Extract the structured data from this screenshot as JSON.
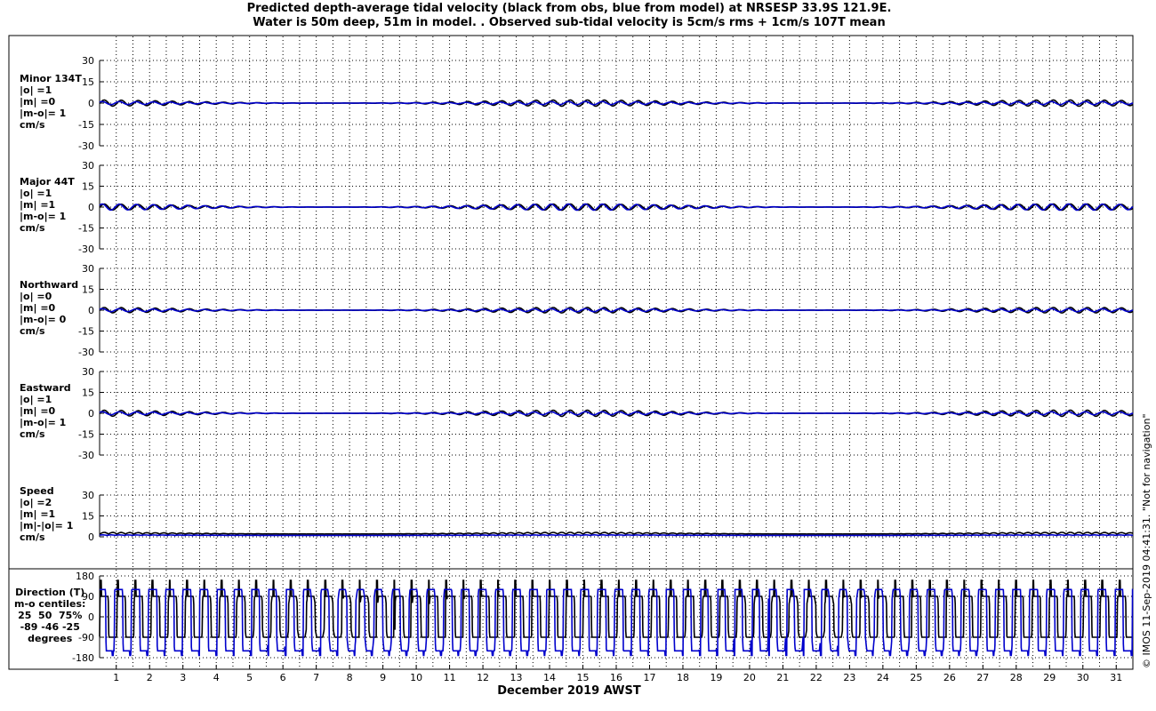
{
  "title": {
    "line1": "Predicted depth-average tidal velocity (black from obs, blue from model) at NRSESP 33.9S 121.9E.",
    "line2": "Water is 50m deep, 51m in model. . Observed sub-tidal velocity is 5cm/s rms + 1cm/s 107T mean"
  },
  "stamp": "© IMOS 11-Sep-2019 04:41:31. \"Not for navigation\"",
  "xlabel": "December 2019 AWST",
  "colors": {
    "obs": "#000000",
    "model": "#0000cc",
    "grid": "#000000"
  },
  "chart_data": [
    {
      "type": "line",
      "name": "minor",
      "label_lines": [
        "Minor 134T",
        "|o| =1",
        "|m| =0",
        "|m-o|= 1",
        "cm/s"
      ],
      "ylim": [
        -30,
        30
      ],
      "yticks": [
        30,
        15,
        0,
        -15,
        -30
      ],
      "x_range_days": [
        0.5,
        31.5
      ],
      "series": [
        {
          "name": "black from obs",
          "amplitude_cm_s": 1
        },
        {
          "name": "blue from model",
          "amplitude_cm_s": 0
        }
      ]
    },
    {
      "type": "line",
      "name": "major",
      "label_lines": [
        "Major 44T",
        "|o| =1",
        "|m| =1",
        "|m-o|= 1",
        "cm/s"
      ],
      "ylim": [
        -30,
        30
      ],
      "yticks": [
        30,
        15,
        0,
        -15,
        -30
      ],
      "x_range_days": [
        0.5,
        31.5
      ],
      "series": [
        {
          "name": "black from obs",
          "amplitude_cm_s": 1
        },
        {
          "name": "blue from model",
          "amplitude_cm_s": 1
        }
      ]
    },
    {
      "type": "line",
      "name": "northward",
      "label_lines": [
        "Northward",
        "|o| =0",
        "|m| =0",
        "|m-o|= 0",
        "cm/s"
      ],
      "ylim": [
        -30,
        30
      ],
      "yticks": [
        30,
        15,
        0,
        -15,
        -30
      ],
      "x_range_days": [
        0.5,
        31.5
      ],
      "series": [
        {
          "name": "black from obs",
          "amplitude_cm_s": 0
        },
        {
          "name": "blue from model",
          "amplitude_cm_s": 0
        }
      ]
    },
    {
      "type": "line",
      "name": "eastward",
      "label_lines": [
        "Eastward",
        "|o| =1",
        "|m| =0",
        "|m-o|= 1",
        "cm/s"
      ],
      "ylim": [
        -30,
        30
      ],
      "yticks": [
        30,
        15,
        0,
        -15,
        -30
      ],
      "x_range_days": [
        0.5,
        31.5
      ],
      "series": [
        {
          "name": "black from obs",
          "amplitude_cm_s": 1
        },
        {
          "name": "blue from model",
          "amplitude_cm_s": 0
        }
      ]
    },
    {
      "type": "line",
      "name": "speed",
      "label_lines": [
        "Speed",
        "|o| =2",
        "|m| =1",
        "|m|-|o|= 1",
        "cm/s"
      ],
      "ylim": [
        0,
        30
      ],
      "yticks": [
        30,
        15,
        0
      ],
      "x_range_days": [
        0.5,
        31.5
      ],
      "series": [
        {
          "name": "black from obs",
          "mean_cm_s": 2
        },
        {
          "name": "blue from model",
          "mean_cm_s": 1
        }
      ]
    },
    {
      "type": "line",
      "name": "direction",
      "label_lines": [
        "Direction (T)",
        "m-o centiles:",
        "25  50  75%",
        "-89 -46 -25",
        "degrees"
      ],
      "ylim": [
        -180,
        180
      ],
      "yticks": [
        180,
        90,
        0,
        -90,
        -180
      ],
      "x_range_days": [
        0.5,
        31.5
      ],
      "series": [
        {
          "name": "black from obs",
          "typical_degrees": [
            -90,
            90
          ]
        },
        {
          "name": "blue from model",
          "typical_degrees": [
            -150,
            120
          ]
        }
      ]
    }
  ],
  "x_ticks": [
    "1",
    "2",
    "3",
    "4",
    "5",
    "6",
    "7",
    "8",
    "9",
    "10",
    "11",
    "12",
    "13",
    "14",
    "15",
    "16",
    "17",
    "18",
    "19",
    "20",
    "21",
    "22",
    "23",
    "24",
    "25",
    "26",
    "27",
    "28",
    "29",
    "30",
    "31"
  ]
}
